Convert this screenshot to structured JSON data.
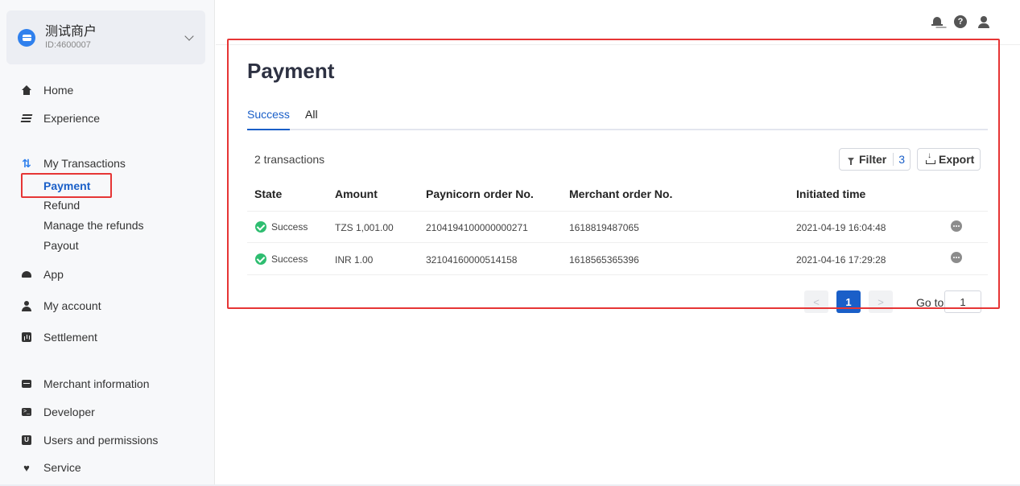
{
  "merchant": {
    "name": "测试商户",
    "id": "ID:4600007"
  },
  "nav": {
    "home": "Home",
    "experience": "Experience",
    "transactions": "My Transactions",
    "sub": {
      "payment": "Payment",
      "refund": "Refund",
      "manage_refunds": "Manage the refunds",
      "payout": "Payout"
    },
    "app": "App",
    "account": "My account",
    "settlement": "Settlement",
    "merchant_info": "Merchant information",
    "developer": "Developer",
    "users": "Users and permissions",
    "service": "Service"
  },
  "header": {
    "help_symbol": "?"
  },
  "page": {
    "title": "Payment",
    "tabs": [
      "Success",
      "All"
    ],
    "count": "2 transactions",
    "filter_label": "Filter",
    "filter_count": "3",
    "export_label": "Export"
  },
  "table": {
    "columns": [
      "State",
      "Amount",
      "Paynicorn order No.",
      "Merchant order No.",
      "Initiated time"
    ],
    "rows": [
      {
        "state": "Success",
        "amount": "TZS 1,001.00",
        "order_no": "2104194100000000271",
        "merchant_no": "1618819487065",
        "time": "2021-04-19 16:04:48"
      },
      {
        "state": "Success",
        "amount": "INR 1.00",
        "order_no": "32104160000514158",
        "merchant_no": "1618565365396",
        "time": "2021-04-16 17:29:28"
      }
    ]
  },
  "pagination": {
    "prev": "<",
    "current": "1",
    "next": ">",
    "goto_label": "Go to",
    "goto_value": "1"
  },
  "colors": {
    "accent": "#1a5fc8",
    "success": "#2ebd70",
    "highlight": "#e63535"
  }
}
